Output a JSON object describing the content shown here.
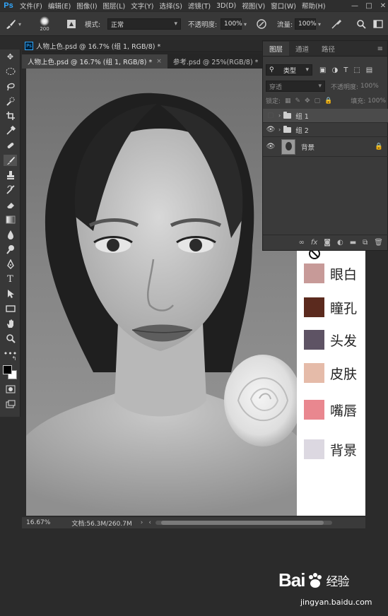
{
  "app": {
    "logo": "Ps"
  },
  "menu": {
    "items": [
      "文件(F)",
      "编辑(E)",
      "图像(I)",
      "图层(L)",
      "文字(Y)",
      "选择(S)",
      "滤镜(T)",
      "3D(D)",
      "视图(V)",
      "窗口(W)",
      "帮助(H)"
    ]
  },
  "window_controls": {
    "minimize": "—",
    "maximize": "□",
    "close": "✕"
  },
  "options": {
    "brush_size": "200",
    "mode_label": "模式:",
    "mode_value": "正常",
    "opacity_label": "不透明度:",
    "opacity_value": "100%",
    "flow_label": "流量:",
    "flow_value": "100%"
  },
  "documents": {
    "floating_title": "人物上色.psd @ 16.7% (组 1, RGB/8) *",
    "tabs": [
      {
        "label": "人物上色.psd @ 16.7% (组 1, RGB/8) *",
        "close": "×",
        "active": true
      },
      {
        "label": "参考.psd @ 25%(RGB/8) *",
        "close": "×",
        "active": false
      }
    ]
  },
  "swatches": [
    {
      "label": "眼白",
      "color": "#c79a98"
    },
    {
      "label": "瞳孔",
      "color": "#5b2a1e"
    },
    {
      "label": "头发",
      "color": "#5e5364"
    },
    {
      "label": "皮肤",
      "color": "#e5bba9"
    },
    {
      "label": "嘴唇",
      "color": "#e9878f"
    },
    {
      "label": "背景",
      "color": "#dcd8e1"
    }
  ],
  "layers_panel": {
    "tabs": [
      "图层",
      "通道",
      "路径"
    ],
    "filter_label": "类型",
    "blend_mode": "穿透",
    "opacity_label": "不透明度:",
    "opacity_value": "100%",
    "lock_label": "锁定:",
    "fill_label": "填充:",
    "fill_value": "100%",
    "layers": [
      {
        "name": "组 1",
        "type": "group",
        "visible": false,
        "selected": true
      },
      {
        "name": "组 2",
        "type": "group",
        "visible": true,
        "selected": false
      },
      {
        "name": "背景",
        "type": "image",
        "visible": true,
        "selected": false,
        "locked": true
      }
    ]
  },
  "status": {
    "zoom": "16.67%",
    "doc_info": "文档:56.3M/260.7M"
  },
  "watermark": {
    "logo": "Bai",
    "logo_suffix": "经验",
    "url": "jingyan.baidu.com"
  },
  "colors": {
    "accent": "#31a8ff",
    "panel_bg": "#3a3a3a",
    "app_bg": "#2b2b2b"
  }
}
